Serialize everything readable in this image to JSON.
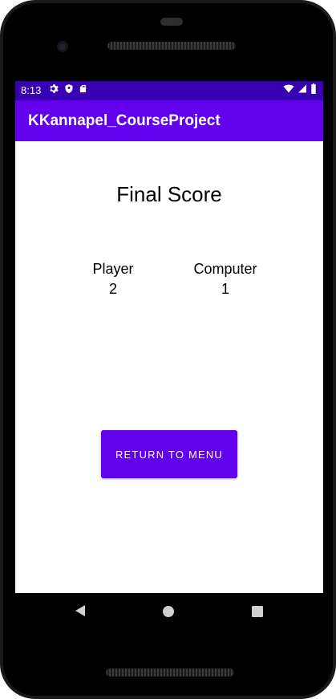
{
  "status_bar": {
    "time": "8:13",
    "icons_left": [
      "gear-icon",
      "shield-icon",
      "sd-card-icon"
    ],
    "icons_right": [
      "wifi-icon",
      "cell-signal-icon",
      "battery-icon"
    ]
  },
  "app_bar": {
    "title": "KKannapel_CourseProject"
  },
  "main": {
    "title": "Final Score",
    "player": {
      "label": "Player",
      "score": "2"
    },
    "computer": {
      "label": "Computer",
      "score": "1"
    },
    "return_button": "RETURN TO MENU"
  },
  "nav_bar": {
    "icons": [
      "back-icon",
      "home-icon",
      "recents-icon"
    ]
  },
  "colors": {
    "status_bar": "#3700b3",
    "primary": "#6200ee",
    "background": "#ffffff",
    "device_bezel": "#1a1a1a"
  }
}
